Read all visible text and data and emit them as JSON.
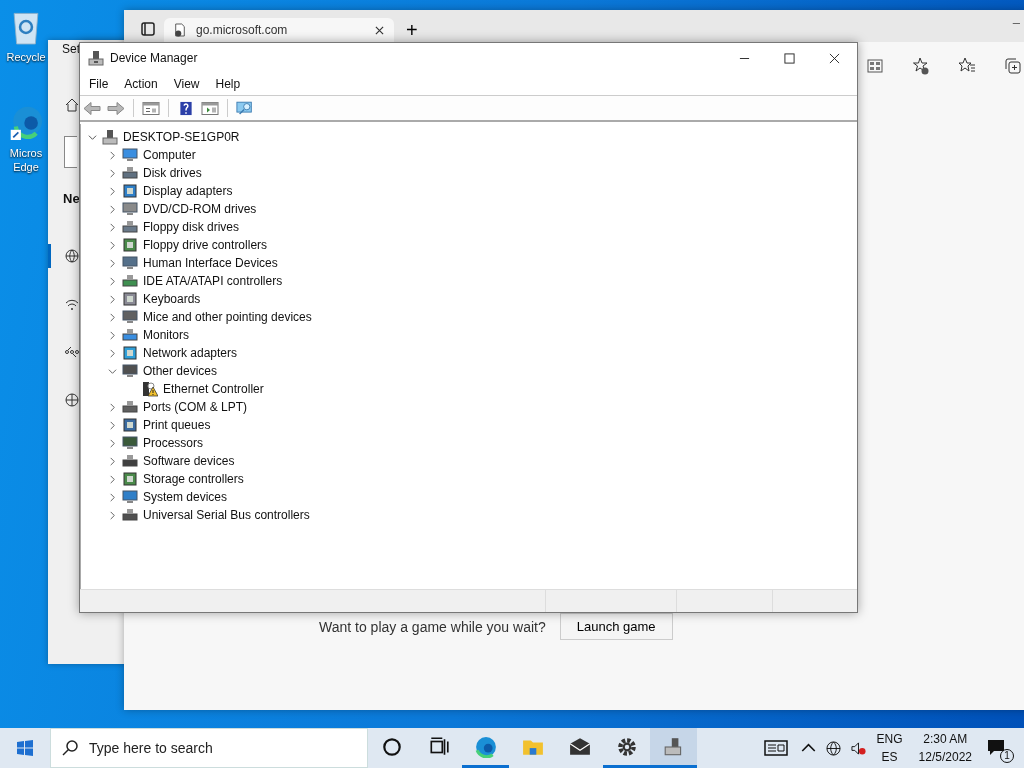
{
  "desktop_icons": [
    {
      "lines": [
        "Recycle"
      ]
    },
    {
      "lines": [
        "Micros",
        "Edge"
      ]
    }
  ],
  "settings_window": {
    "title": "Set",
    "heading": "Ne"
  },
  "browser": {
    "tab": {
      "title": "go.microsoft.com",
      "selected": true
    },
    "new_tab": "+",
    "minimize": "–",
    "prompt": "Want to play a game while you wait?",
    "launch_button": "Launch game"
  },
  "device_manager": {
    "title": "Device Manager",
    "menu": [
      "File",
      "Action",
      "View",
      "Help"
    ],
    "toolbar": [
      {
        "kind": "back",
        "disabled": true
      },
      {
        "kind": "forward",
        "disabled": true
      },
      {
        "kind": "properties",
        "disabled": false
      },
      {
        "kind": "help",
        "disabled": false
      },
      {
        "kind": "showhide",
        "disabled": false
      },
      {
        "kind": "scan",
        "disabled": false
      }
    ],
    "tree": {
      "label": "DESKTOP-SE1GP0R",
      "expanded": true,
      "children": [
        {
          "label": "Computer",
          "expanded": false
        },
        {
          "label": "Disk drives",
          "expanded": false
        },
        {
          "label": "Display adapters",
          "expanded": false
        },
        {
          "label": "DVD/CD-ROM drives",
          "expanded": false
        },
        {
          "label": "Floppy disk drives",
          "expanded": false
        },
        {
          "label": "Floppy drive controllers",
          "expanded": false
        },
        {
          "label": "Human Interface Devices",
          "expanded": false
        },
        {
          "label": "IDE ATA/ATAPI controllers",
          "expanded": false
        },
        {
          "label": "Keyboards",
          "expanded": false
        },
        {
          "label": "Mice and other pointing devices",
          "expanded": false
        },
        {
          "label": "Monitors",
          "expanded": false
        },
        {
          "label": "Network adapters",
          "expanded": false
        },
        {
          "label": "Other devices",
          "expanded": true,
          "children": [
            {
              "label": "Ethernet Controller",
              "warning": true
            }
          ]
        },
        {
          "label": "Ports (COM & LPT)",
          "expanded": false
        },
        {
          "label": "Print queues",
          "expanded": false
        },
        {
          "label": "Processors",
          "expanded": false
        },
        {
          "label": "Software devices",
          "expanded": false
        },
        {
          "label": "Storage controllers",
          "expanded": false
        },
        {
          "label": "System devices",
          "expanded": false
        },
        {
          "label": "Universal Serial Bus controllers",
          "expanded": false
        }
      ]
    }
  },
  "taskbar": {
    "search_placeholder": "Type here to search",
    "apps": [
      {
        "kind": "cortana",
        "running": false,
        "selected": false
      },
      {
        "kind": "taskview",
        "running": false,
        "selected": false
      },
      {
        "kind": "edge",
        "running": true,
        "selected": false
      },
      {
        "kind": "explorer",
        "running": false,
        "selected": false
      },
      {
        "kind": "mail",
        "running": false,
        "selected": false
      },
      {
        "kind": "settings",
        "running": true,
        "selected": false
      },
      {
        "kind": "devmgr",
        "running": true,
        "selected": true
      }
    ],
    "language": [
      "ENG",
      "ES"
    ],
    "time": "2:30 AM",
    "date": "12/5/2022",
    "notifications": "1",
    "volume_muted": true
  }
}
